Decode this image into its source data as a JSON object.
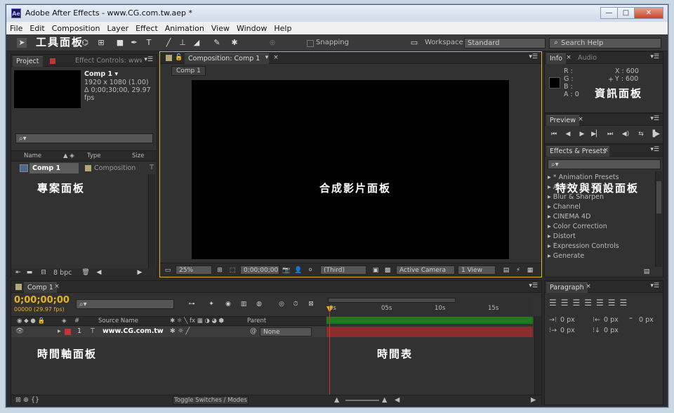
{
  "app": {
    "title": "Adobe After Effects - www.CG.com.tw.aep *",
    "logo": "Ae"
  },
  "window_buttons": {
    "minimize": "—",
    "maximize": "□",
    "close": "✕"
  },
  "menu": [
    "File",
    "Edit",
    "Composition",
    "Layer",
    "Effect",
    "Animation",
    "View",
    "Window",
    "Help"
  ],
  "toolbar": {
    "snapping": "Snapping",
    "workspace_label": "Workspace:",
    "workspace_value": "Standard",
    "search_placeholder": "Search Help"
  },
  "project": {
    "tab": "Project",
    "tab2": "Effect Controls: www",
    "comp_name": "Comp 1 ▾",
    "comp_res": "1920 x 1080 (1.00)",
    "comp_duration": "Δ 0;00;30;00, 29.97 fps",
    "search": "⌕▾",
    "col_name": "Name",
    "col_type": "Type",
    "col_size": "Size",
    "item_name": "Comp 1",
    "item_type": "Composition",
    "bpc": "8 bpc"
  },
  "composition": {
    "tab": "Composition: Comp 1",
    "breadcrumb": "Comp 1",
    "zoom": "25%",
    "timecode": "0;00;00;00",
    "resolution": "(Third)",
    "camera": "Active Camera",
    "view": "1 View"
  },
  "info": {
    "tab": "Info",
    "tab2": "Audio",
    "r": "R :",
    "g": "G :",
    "b": "B :",
    "a": "A : 0",
    "x": "X : 600",
    "y": "Y : 600"
  },
  "preview": {
    "tab": "Preview"
  },
  "effects": {
    "tab": "Effects & Presets",
    "search": "⌕▾",
    "items": [
      "* Animation Presets",
      "Audio",
      "Blur & Sharpen",
      "Channel",
      "CINEMA 4D",
      "Color Correction",
      "Distort",
      "Expression Controls",
      "Generate"
    ]
  },
  "timeline": {
    "tab": "Comp 1",
    "timecode": "0;00;00;00",
    "fps": "00000 (29.97 fps)",
    "search": "⌕▾",
    "col_source": "Source Name",
    "col_parent": "Parent",
    "col_hash": "#",
    "layer_num": "1",
    "layer_name": "www.CG.com.tw",
    "parent_value": "None",
    "toggle": "Toggle Switches / Modes",
    "ruler": [
      "0s",
      "05s",
      "10s",
      "15s"
    ]
  },
  "paragraph": {
    "tab": "Paragraph",
    "v1": "0 px",
    "v2": "0 px",
    "v3": "0 px",
    "v4": "0 px",
    "v5": "0 px"
  },
  "annotations": {
    "tools": "工具面板",
    "info": "資訊面板",
    "project": "專案面板",
    "composition": "合成影片面板",
    "effects": "特效與預設面板",
    "timeline": "時間軸面板",
    "timetable": "時間表"
  },
  "colors": {
    "accent": "#e8b21f",
    "layer_bar": "#8a2d2d",
    "label_red": "#c43434"
  }
}
